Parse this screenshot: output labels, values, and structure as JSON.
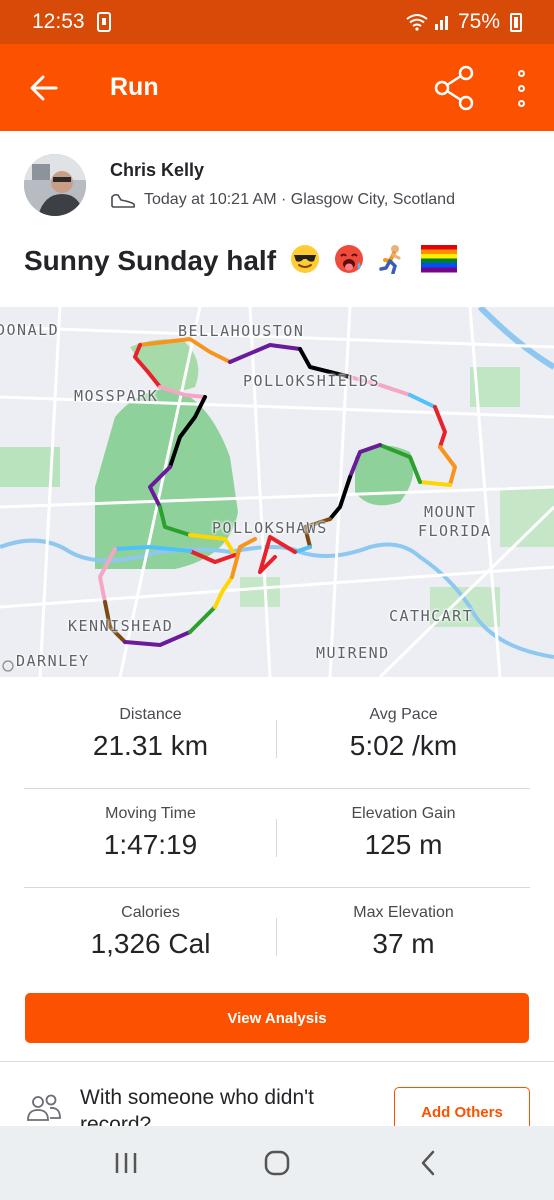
{
  "status_bar": {
    "time": "12:53",
    "battery": "75%"
  },
  "app_bar": {
    "title": "Run",
    "back_icon": "arrow-left-icon",
    "share_icon": "share-icon",
    "more_icon": "more-vertical-icon"
  },
  "author": {
    "name": "Chris Kelly",
    "meta": "Today at 10:21 AM · Glasgow City, Scotland"
  },
  "activity": {
    "title": "Sunny Sunday half",
    "emojis": [
      "sunglasses-face",
      "hot-face",
      "runner",
      "rainbow-flag"
    ]
  },
  "map": {
    "labels": {
      "donald": "DONALD",
      "bellahouston": "BELLAHOUSTON",
      "mosspark": "MOSSPARK",
      "pollokshields": "POLLOKSHIELDS",
      "pollokshaws": "POLLOKSHAWS",
      "mount": "MOUNT",
      "florida": "FLORIDA",
      "cathcart": "CATHCART",
      "kennishead": "KENNISHEAD",
      "darnley": "DARNLEY",
      "muirend": "MUIREND"
    },
    "route_colors": [
      "#000000",
      "#e8212b",
      "#f7941d",
      "#ffd700",
      "#2ca02c",
      "#1e90ff",
      "#6a1b9a",
      "#f4a7c4",
      "#4fc3f7",
      "#7b4a12"
    ]
  },
  "stats": [
    {
      "label": "Distance",
      "value": "21.31 km"
    },
    {
      "label": "Avg Pace",
      "value": "5:02 /km"
    },
    {
      "label": "Moving Time",
      "value": "1:47:19"
    },
    {
      "label": "Elevation Gain",
      "value": "125 m"
    },
    {
      "label": "Calories",
      "value": "1,326 Cal"
    },
    {
      "label": "Max Elevation",
      "value": "37 m"
    }
  ],
  "buttons": {
    "view_analysis": "View Analysis",
    "add_others": "Add Others"
  },
  "with_others": {
    "text": "With someone who didn't record?"
  },
  "colors": {
    "brand": "#fc5200",
    "status_bar": "#d84a08"
  }
}
